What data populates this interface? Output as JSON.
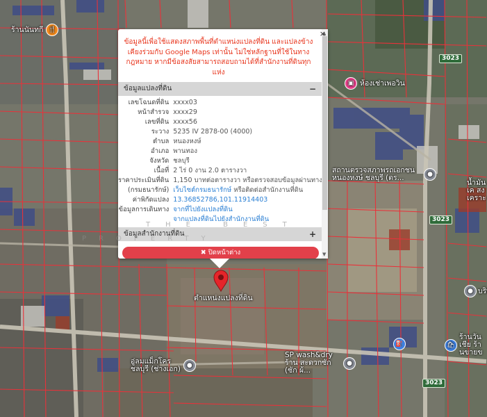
{
  "popup": {
    "notice": "ข้อมูลนี้เพื่อใช้แสดงสภาพพื้นที่ตำแหน่งแปลงที่ดิน และแปลงข้างเคียงร่วมกับ Google Maps เท่านั้น ไม่ใช่หลักฐานที่ใช้ในทางกฎหมาย หากมีข้อสงสัยสามารถสอบถามได้ที่สำนักงานที่ดินทุกแห่ง",
    "close_icon": "×",
    "section1": {
      "title": "ข้อมูลแปลงที่ดิน",
      "toggle": "−"
    },
    "rows": [
      {
        "k": "เลขโฉนดที่ดิน",
        "v": "xxxx03"
      },
      {
        "k": "หน้าสำรวจ",
        "v": "xxxx29"
      },
      {
        "k": "เลขที่ดิน",
        "v": "xxxx56"
      },
      {
        "k": "ระวาง",
        "v": "5235 IV 2878-00 (4000)"
      },
      {
        "k": "ตำบล",
        "v": "หนองหงษ์"
      },
      {
        "k": "อำเภอ",
        "v": "พานทอง"
      },
      {
        "k": "จังหวัด",
        "v": "ชลบุรี"
      },
      {
        "k": "เนื้อที่",
        "v": "2 ไร่ 0 งาน 2.0 ตารางวา"
      },
      {
        "k": "ราคาประเมินที่ดิน",
        "v": "1,150 บาทต่อตารางวา หรือตรวจสอบข้อมูลผ่านทาง"
      },
      {
        "k": "(กรมธนารักษ์)",
        "v": "เว็บไซต์กรมธนารักษ์",
        "v2": " หรือติดต่อสำนักงานที่ดิน"
      },
      {
        "k": "ค่าพิกัดแปลง",
        "v": "13.36852786,101.11914403"
      },
      {
        "k": "ข้อมูลการเดินทาง",
        "v": "จากที่ไปยังแปลงที่ดิน"
      },
      {
        "k": "",
        "v": "จากแปลงที่ดินไปยังสำนักงานที่ดิน"
      }
    ],
    "section2": {
      "title": "ข้อมูลสำนักงานที่ดิน",
      "toggle": "+"
    },
    "close_button": "✖ ปิดหน้าต่าง",
    "scroll_up": "▲",
    "scroll_down": "▼"
  },
  "watermark": {
    "line1": "THE BEST",
    "line2": "PROPERTY"
  },
  "marker": {
    "label": "ตำแหน่งแปลงที่ดิน",
    "icon": "location-pin-icon",
    "color": "#e5252a"
  },
  "pois": [
    {
      "name": "ร้านนันทกี",
      "icon": "restaurant-icon",
      "color": "#f28a1e"
    },
    {
      "name": "ห้องเช่าเพอวิน",
      "icon": "hotel-icon",
      "color": "#e8418c"
    },
    {
      "name": "สถานตรวจสภาพรถเอกชน หนองหงษ์ ชลบุรี (ตร...",
      "icon": "place-icon",
      "color": "#8a8f99"
    },
    {
      "name": "น้ำมันเค สงเคราะ",
      "icon": "place-icon",
      "color": "#8a8f99"
    },
    {
      "name": "บริษ",
      "icon": "place-icon",
      "color": "#8a8f99"
    },
    {
      "name": "ร้านวันเชีย ร้านขายข",
      "icon": "shopping-icon",
      "color": "#3d7fe0"
    },
    {
      "name": "SP wash&dry ร้าน สะดวกซัก (ซัก ผ้...",
      "icon": "place-icon",
      "color": "#8a8f99"
    },
    {
      "name": "ชลบุรี (ช่างเอก)",
      "line1": "อู่ลมแม็กโคร",
      "icon": "place-icon",
      "color": "#8a8f99"
    }
  ],
  "road_shields": [
    "3023",
    "3023",
    "3023"
  ],
  "colors": {
    "parcel_line": "#e8323a",
    "road": "#c9c4b6",
    "notice": "#e8361e",
    "close_button": "#e2404a",
    "link": "#2a7fd4"
  }
}
